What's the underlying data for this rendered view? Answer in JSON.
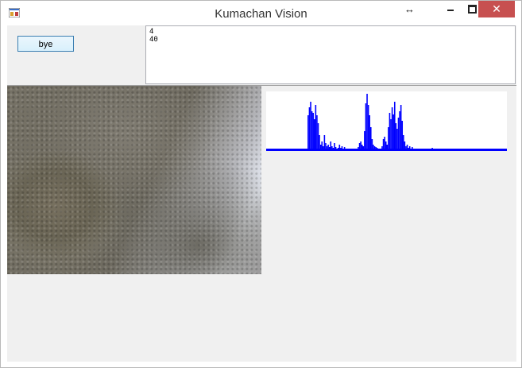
{
  "window": {
    "title": "Kumachan Vision"
  },
  "titlebar": {
    "resize_glyph": "↔",
    "close_glyph": "✕"
  },
  "controls": {
    "bye_label": "bye"
  },
  "output": {
    "lines": [
      "4",
      "40"
    ]
  },
  "histogram": {
    "color": "#0000ff",
    "bins": [
      2,
      2,
      2,
      2,
      2,
      2,
      2,
      2,
      2,
      2,
      2,
      2,
      2,
      2,
      2,
      2,
      2,
      2,
      2,
      2,
      2,
      2,
      2,
      2,
      2,
      2,
      2,
      2,
      2,
      2,
      2,
      3,
      2,
      45,
      55,
      62,
      50,
      48,
      40,
      58,
      45,
      35,
      20,
      8,
      12,
      6,
      20,
      10,
      6,
      8,
      5,
      12,
      6,
      4,
      10,
      5,
      3,
      4,
      8,
      4,
      6,
      3,
      5,
      2,
      2,
      2,
      2,
      2,
      2,
      2,
      2,
      2,
      3,
      5,
      10,
      12,
      8,
      6,
      25,
      60,
      72,
      58,
      45,
      30,
      15,
      8,
      6,
      5,
      4,
      3,
      2,
      2,
      6,
      15,
      18,
      12,
      8,
      30,
      48,
      40,
      55,
      46,
      62,
      35,
      28,
      42,
      50,
      58,
      38,
      20,
      12,
      6,
      8,
      4,
      6,
      3,
      5,
      2,
      3,
      2,
      2,
      2,
      2,
      2,
      2,
      2,
      2,
      2,
      2,
      2,
      2,
      2,
      4,
      2,
      2,
      2,
      2,
      2,
      2,
      2,
      2,
      2,
      2,
      2,
      2,
      2,
      2,
      2,
      2,
      2,
      3,
      2,
      2,
      2,
      2,
      2,
      2,
      2,
      2,
      2,
      2,
      2,
      2,
      2,
      2,
      2,
      2,
      2,
      2,
      2,
      2,
      2,
      2,
      2,
      2,
      2,
      2,
      2,
      2,
      2,
      2,
      2,
      2,
      2,
      2,
      2,
      2,
      2,
      2,
      2,
      2,
      2
    ]
  }
}
